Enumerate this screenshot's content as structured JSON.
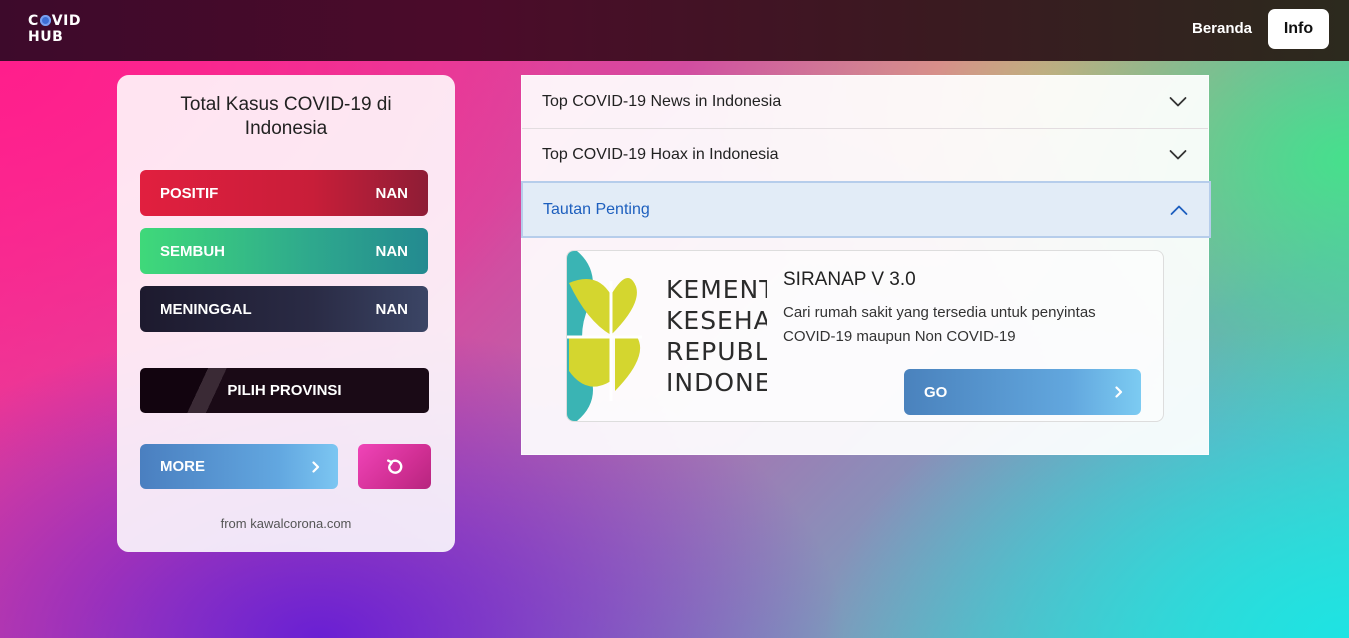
{
  "navbar": {
    "logo_line1_a": "C",
    "logo_line1_b": "VID",
    "logo_line2": "HUB",
    "links": {
      "home": "Beranda",
      "info": "Info"
    }
  },
  "stats": {
    "title": "Total Kasus COVID-19 di Indonesia",
    "positif": {
      "label": "POSITIF",
      "value": "NAN"
    },
    "sembuh": {
      "label": "SEMBUH",
      "value": "NAN"
    },
    "meninggal": {
      "label": "MENINGGAL",
      "value": "NAN"
    },
    "pilih_label": "PILIH PROVINSI",
    "more_label": "MORE",
    "more_icon": "chevron-right-icon",
    "reset_icon": "refresh-icon",
    "source": "from kawalcorona.com"
  },
  "accordion": {
    "items": [
      {
        "label": "Top COVID-19 News in Indonesia",
        "expanded": false
      },
      {
        "label": "Top COVID-19 Hoax in Indonesia",
        "expanded": false
      },
      {
        "label": "Tautan Penting",
        "expanded": true
      }
    ]
  },
  "link_card": {
    "image_text": [
      "KEMENT",
      "KESEHA",
      "REPUBL",
      "INDONE"
    ],
    "title": "SIRANAP V 3.0",
    "description": "Cari rumah sakit yang tersedia untuk penyintas COVID-19 maupun Non COVID-19",
    "button_label": "GO"
  },
  "colors": {
    "positif": "#e11f3f",
    "sembuh": "#3fd97a",
    "meninggal": "#1d1a2e",
    "accent_blue": "#1d5fbe",
    "kemenkes_teal": "#3ab4b4",
    "kemenkes_yellow": "#d4d62f"
  }
}
